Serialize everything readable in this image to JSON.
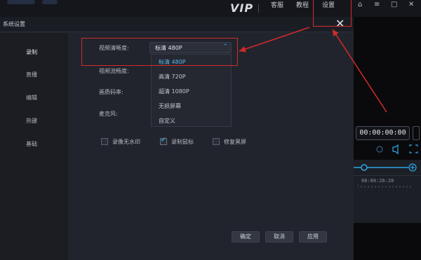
{
  "app": {
    "logo_text": "VIP",
    "menu": [
      "客服",
      "教程",
      "设置"
    ]
  },
  "dialog": {
    "title": "系统设置",
    "close_glyph": "✕"
  },
  "sidebar": {
    "items": [
      {
        "label": "录制",
        "active": true
      },
      {
        "label": "直播",
        "active": false
      },
      {
        "label": "编辑",
        "active": false
      },
      {
        "label": "热键",
        "active": false
      },
      {
        "label": "基础",
        "active": false
      }
    ]
  },
  "fields": {
    "video_clarity_label": "视频清晰度:",
    "video_fluency_label": "视频流畅度:",
    "quality_bitrate_label": "画质码率:",
    "microphone_label": "麦克风:"
  },
  "select": {
    "value": "标清 480P",
    "options": [
      "标清 480P",
      "高清 720P",
      "超清 1080P",
      "无损屏幕",
      "自定义"
    ],
    "selected_index": 0
  },
  "checkboxes": [
    {
      "label": "录像无水印",
      "checked": false
    },
    {
      "label": "录制鼠标",
      "checked": true
    },
    {
      "label": "修复黑屏",
      "checked": false
    }
  ],
  "buttons": {
    "ok": "确定",
    "cancel": "取消",
    "apply": "应用"
  },
  "player": {
    "timecode": "00:00:00:00",
    "ruler_time": "00:00:26:20"
  },
  "colors": {
    "accent": "#1ca9e0",
    "annotation": "#d32b2b"
  }
}
